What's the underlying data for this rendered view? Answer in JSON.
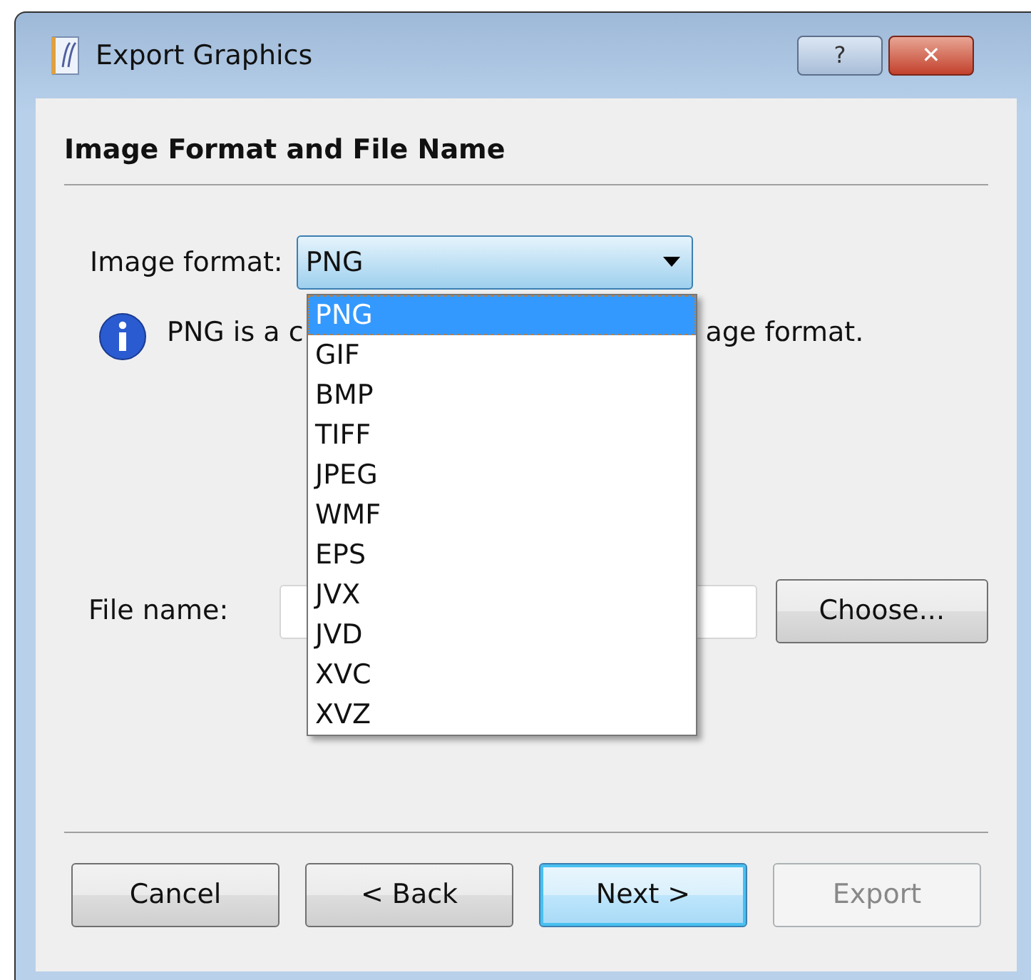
{
  "window": {
    "title": "Export Graphics",
    "title_buttons": [
      "?",
      "✕"
    ]
  },
  "page": {
    "heading": "Image Format and File Name"
  },
  "image_format": {
    "label": "Image format:",
    "value": "PNG",
    "expanded": true,
    "options": [
      {
        "label": "PNG",
        "selected": true
      },
      {
        "label": "GIF",
        "selected": false
      },
      {
        "label": "BMP",
        "selected": false
      },
      {
        "label": "TIFF",
        "selected": false
      },
      {
        "label": "JPEG",
        "selected": false
      },
      {
        "label": "WMF",
        "selected": false
      },
      {
        "label": "EPS",
        "selected": false
      },
      {
        "label": "JVX",
        "selected": false
      },
      {
        "label": "JVD",
        "selected": false
      },
      {
        "label": "XVC",
        "selected": false
      },
      {
        "label": "XVZ",
        "selected": false
      }
    ]
  },
  "info": {
    "text_start": "PNG is a c",
    "text_end": "age format."
  },
  "file_name": {
    "label": "File name:",
    "choose_button": "Choose..."
  },
  "buttons": [
    {
      "label": "Cancel",
      "disabled": false,
      "default": false
    },
    {
      "label": "< Back",
      "disabled": false,
      "default": false
    },
    {
      "label": "Next >",
      "disabled": false,
      "default": true
    },
    {
      "label": "Export",
      "disabled": true,
      "default": false
    }
  ]
}
